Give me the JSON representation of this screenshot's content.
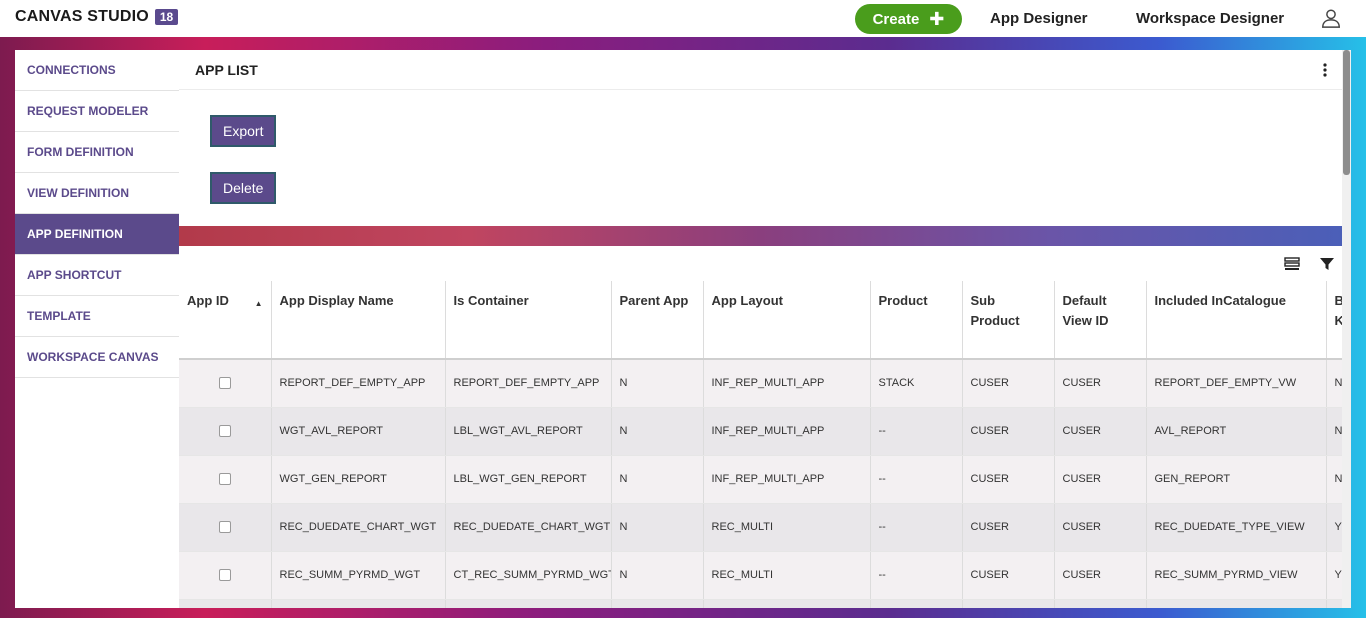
{
  "header": {
    "brand": "CANVAS STUDIO",
    "version_badge": "18",
    "create_label": "Create",
    "create_icon": "plus-icon",
    "nav": [
      "App Designer",
      "Workspace Designer"
    ],
    "user_icon": "user-icon"
  },
  "sidebar": {
    "items": [
      {
        "label": "CONNECTIONS",
        "active": false
      },
      {
        "label": "REQUEST MODELER",
        "active": false
      },
      {
        "label": "FORM DEFINITION",
        "active": false
      },
      {
        "label": "VIEW DEFINITION",
        "active": false
      },
      {
        "label": "APP DEFINITION",
        "active": true
      },
      {
        "label": "APP SHORTCUT",
        "active": false
      },
      {
        "label": "TEMPLATE",
        "active": false
      },
      {
        "label": "WORKSPACE CANVAS",
        "active": false
      }
    ]
  },
  "panel": {
    "title": "APP LIST",
    "export_label": "Export",
    "delete_label": "Delete"
  },
  "table": {
    "columns": [
      "App ID",
      "App Display Name",
      "Is Container",
      "Parent App",
      "App Layout",
      "Product",
      "Sub Product",
      "Default View ID",
      "Included InCatalogue",
      "B K"
    ],
    "sort_column": "App ID",
    "rows": [
      [
        "REPORT_DEF_EMPTY_APP",
        "REPORT_DEF_EMPTY_APP",
        "N",
        "INF_REP_MULTI_APP",
        "STACK",
        "CUSER",
        "CUSER",
        "REPORT_DEF_EMPTY_VW",
        "N"
      ],
      [
        "WGT_AVL_REPORT",
        "LBL_WGT_AVL_REPORT",
        "N",
        "INF_REP_MULTI_APP",
        "--",
        "CUSER",
        "CUSER",
        "AVL_REPORT",
        "N"
      ],
      [
        "WGT_GEN_REPORT",
        "LBL_WGT_GEN_REPORT",
        "N",
        "INF_REP_MULTI_APP",
        "--",
        "CUSER",
        "CUSER",
        "GEN_REPORT",
        "N"
      ],
      [
        "REC_DUEDATE_CHART_WGT",
        "REC_DUEDATE_CHART_WGT",
        "N",
        "REC_MULTI",
        "--",
        "CUSER",
        "CUSER",
        "REC_DUEDATE_TYPE_VIEW",
        "Y"
      ],
      [
        "REC_SUMM_PYRMD_WGT",
        "CT_REC_SUMM_PYRMD_WGT",
        "N",
        "REC_MULTI",
        "--",
        "CUSER",
        "CUSER",
        "REC_SUMM_PYRMD_VIEW",
        "Y"
      ]
    ]
  }
}
